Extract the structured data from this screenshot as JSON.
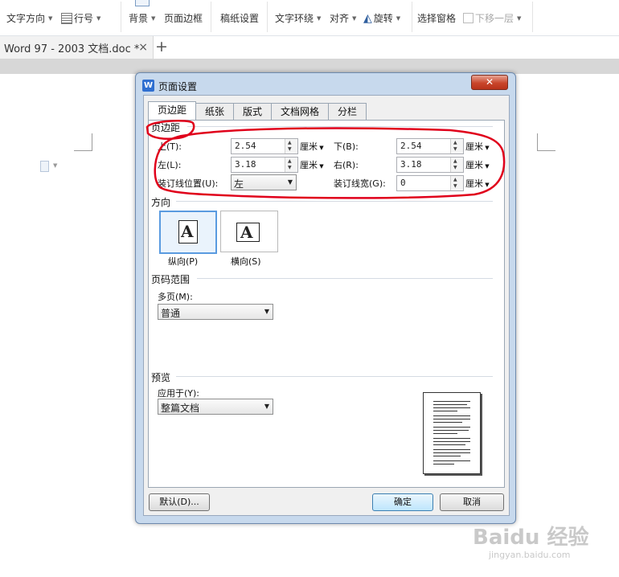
{
  "ribbon": {
    "text_direction": "文字方向",
    "line_number": "行号",
    "background": "背景",
    "page_border": "页面边框",
    "manuscript": "稿纸设置",
    "text_wrap": "文字环绕",
    "align": "对齐",
    "rotate": "旋转",
    "selection_pane": "选择窗格",
    "send_backward": "下移一层"
  },
  "doc_tab": {
    "title": "Word 97 - 2003 文档.doc *",
    "close": "×",
    "new": "+"
  },
  "dialog": {
    "title": "页面设置",
    "close": "✕",
    "tabs": [
      "页边距",
      "纸张",
      "版式",
      "文档网格",
      "分栏"
    ],
    "margins": {
      "header": "页边距",
      "top_label": "上(T):",
      "top_value": "2.54",
      "bottom_label": "下(B):",
      "bottom_value": "2.54",
      "left_label": "左(L):",
      "left_value": "3.18",
      "right_label": "右(R):",
      "right_value": "3.18",
      "unit": "厘米",
      "gutter_pos_label": "装订线位置(U):",
      "gutter_pos_value": "左",
      "gutter_width_label": "装订线宽(G):",
      "gutter_width_value": "0"
    },
    "orientation": {
      "header": "方向",
      "portrait": "纵向(P)",
      "landscape": "横向(S)",
      "glyph": "A"
    },
    "pages": {
      "header": "页码范围",
      "multiple_label": "多页(M):",
      "multiple_value": "普通"
    },
    "preview": {
      "header": "预览",
      "apply_label": "应用于(Y):",
      "apply_value": "整篇文档"
    },
    "buttons": {
      "default": "默认(D)...",
      "ok": "确定",
      "cancel": "取消"
    }
  },
  "watermark": {
    "brand": "Baidu 经验",
    "url": "jingyan.baidu.com"
  },
  "colors": {
    "annotation": "#e0001b",
    "dialog_frame": "#c7d9ed",
    "accent": "#2f6fd0"
  }
}
